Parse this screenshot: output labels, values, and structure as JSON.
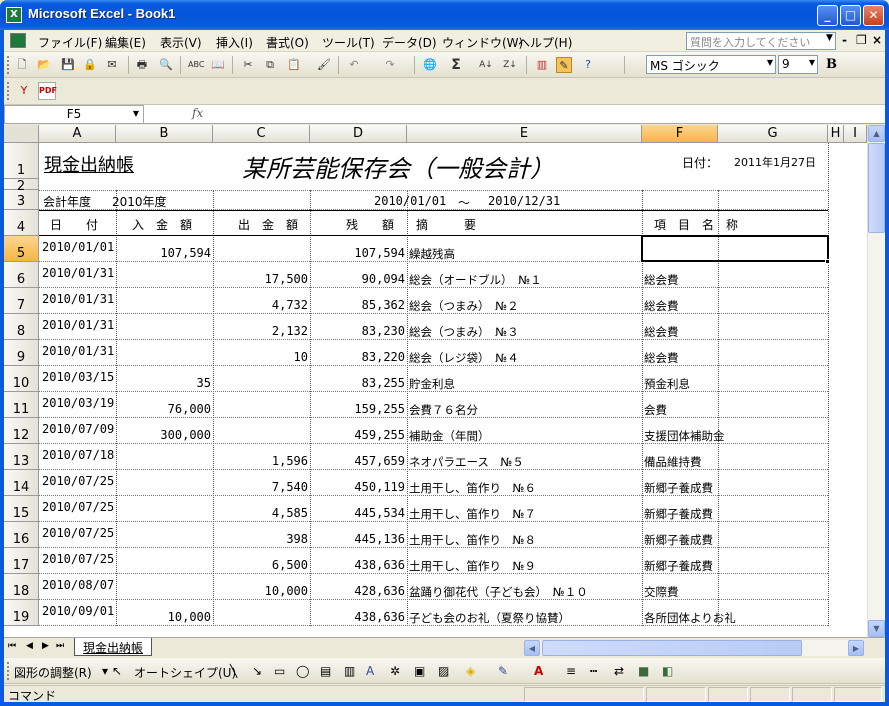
{
  "window": {
    "title": "Microsoft Excel - Book1"
  },
  "menu": {
    "items": [
      "ファイル(F)",
      "編集(E)",
      "表示(V)",
      "挿入(I)",
      "書式(O)",
      "ツール(T)",
      "データ(D)",
      "ウィンドウ(W)",
      "ヘルプ(H)"
    ],
    "help_placeholder": "質問を入力してください"
  },
  "toolbar": {
    "font_name": "MS ゴシック",
    "font_size": "9",
    "bold_label": "B",
    "pdf_label": "PDF"
  },
  "formula_bar": {
    "name_box": "F5",
    "fx_label": "fx",
    "formula": ""
  },
  "sheet": {
    "columns": [
      "A",
      "B",
      "C",
      "D",
      "E",
      "F",
      "G",
      "H",
      "I"
    ],
    "selected_column": "F",
    "selected_row": "5",
    "rows": [
      "1",
      "2",
      "3",
      "4",
      "5",
      "6",
      "7",
      "8",
      "9",
      "10",
      "11",
      "12",
      "13",
      "14",
      "15",
      "16",
      "17",
      "18",
      "19"
    ],
    "ledger_title": "現金出納帳",
    "org_title": "某所芸能保存会（一般会計）",
    "date_label": "日付：",
    "date_value": "2011年1月27日",
    "fiscal_label": "会計年度",
    "fiscal_year": "2010年度",
    "period_start": "2010/01/01",
    "period_sep": "～",
    "period_end": "2010/12/31",
    "headers": {
      "date": "日　　付",
      "income": "入　金　額",
      "expense": "出　金　額",
      "balance": "残　　額",
      "summary": "摘　　　要",
      "item": "項　目　名　称"
    },
    "entries": [
      {
        "date": "2010/01/01",
        "income": "107,594",
        "expense": "",
        "balance": "107,594",
        "summary": "繰越残高",
        "item": ""
      },
      {
        "date": "2010/01/31",
        "income": "",
        "expense": "17,500",
        "balance": "90,094",
        "summary": "総会（オードブル）　№１",
        "item": "総会費"
      },
      {
        "date": "2010/01/31",
        "income": "",
        "expense": "4,732",
        "balance": "85,362",
        "summary": "総会（つまみ）　№２",
        "item": "総会費"
      },
      {
        "date": "2010/01/31",
        "income": "",
        "expense": "2,132",
        "balance": "83,230",
        "summary": "総会（つまみ）　№３",
        "item": "総会費"
      },
      {
        "date": "2010/01/31",
        "income": "",
        "expense": "10",
        "balance": "83,220",
        "summary": "総会（レジ袋）　№４",
        "item": "総会費"
      },
      {
        "date": "2010/03/15",
        "income": "35",
        "expense": "",
        "balance": "83,255",
        "summary": "貯金利息",
        "item": "預金利息"
      },
      {
        "date": "2010/03/19",
        "income": "76,000",
        "expense": "",
        "balance": "159,255",
        "summary": "会費７６名分",
        "item": "会費"
      },
      {
        "date": "2010/07/09",
        "income": "300,000",
        "expense": "",
        "balance": "459,255",
        "summary": "補助金（年間）",
        "item": "支援団体補助金"
      },
      {
        "date": "2010/07/18",
        "income": "",
        "expense": "1,596",
        "balance": "457,659",
        "summary": "ネオパラエース　№５",
        "item": "備品維持費"
      },
      {
        "date": "2010/07/25",
        "income": "",
        "expense": "7,540",
        "balance": "450,119",
        "summary": "土用干し、笛作り　№６",
        "item": "新郷子養成費"
      },
      {
        "date": "2010/07/25",
        "income": "",
        "expense": "4,585",
        "balance": "445,534",
        "summary": "土用干し、笛作り　№７",
        "item": "新郷子養成費"
      },
      {
        "date": "2010/07/25",
        "income": "",
        "expense": "398",
        "balance": "445,136",
        "summary": "土用干し、笛作り　№８",
        "item": "新郷子養成費"
      },
      {
        "date": "2010/07/25",
        "income": "",
        "expense": "6,500",
        "balance": "438,636",
        "summary": "土用干し、笛作り　№９",
        "item": "新郷子養成費"
      },
      {
        "date": "2010/08/07",
        "income": "",
        "expense": "10,000",
        "balance": "428,636",
        "summary": "盆踊り御花代（子ども会）　№１０",
        "item": "交際費"
      },
      {
        "date": "2010/09/01",
        "income": "10,000",
        "expense": "",
        "balance": "438,636",
        "summary": "子ども会のお礼（夏祭り協賛）",
        "item": "各所団体よりお礼"
      }
    ]
  },
  "tabs": {
    "sheet_name": "現金出納帳"
  },
  "drawing": {
    "adjust_label": "図形の調整(R)",
    "autoshape_label": "オートシェイプ(U)"
  },
  "status": {
    "text": "コマンド"
  }
}
